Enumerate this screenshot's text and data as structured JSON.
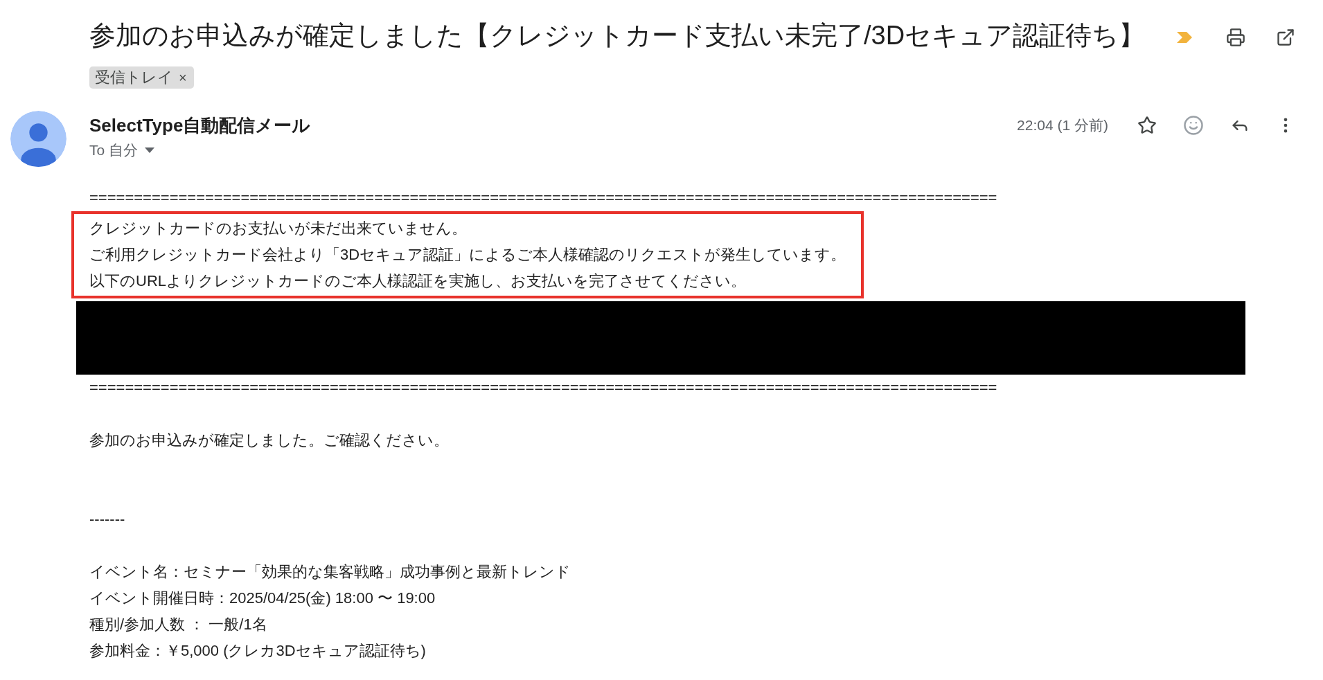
{
  "subject": {
    "title": "参加のお申込みが確定しました【クレジットカード支払い未完了/3Dセキュア認証待ち】",
    "important": true,
    "label": {
      "text": "受信トレイ",
      "remove": "×"
    }
  },
  "message": {
    "sender": "SelectType自動配信メール",
    "recipient": "To 自分",
    "time": "22:04 (1 分前)",
    "starred": false,
    "body": [
      {
        "kind": "text",
        "lines": [
          "======================================================================================================"
        ]
      },
      {
        "kind": "highlighted",
        "lines": [
          "クレジットカードのお支払いが未だ出来ていません。",
          "ご利用クレジットカード会社より「3Dセキュア認証」によるご本人様確認のリクエストが発生しています。",
          "以下のURLよりクレジットカードのご本人様認証を実施し、お支払いを完了させてください。"
        ]
      },
      {
        "kind": "redacted"
      },
      {
        "kind": "text",
        "lines": [
          "======================================================================================================"
        ]
      },
      {
        "kind": "blank"
      },
      {
        "kind": "text",
        "lines": [
          "参加のお申込みが確定しました。ご確認ください。"
        ]
      },
      {
        "kind": "blank"
      },
      {
        "kind": "blank"
      },
      {
        "kind": "text",
        "lines": [
          "-------"
        ]
      },
      {
        "kind": "blank"
      },
      {
        "kind": "text",
        "lines": [
          "イベント名：セミナー「効果的な集客戦略」成功事例と最新トレンド",
          "イベント開催日時：2025/04/25(金) 18:00 〜 19:00",
          "種別/参加人数 ： 一般/1名",
          "参加料金：￥5,000 (クレカ3Dセキュア認証待ち)"
        ]
      }
    ]
  }
}
